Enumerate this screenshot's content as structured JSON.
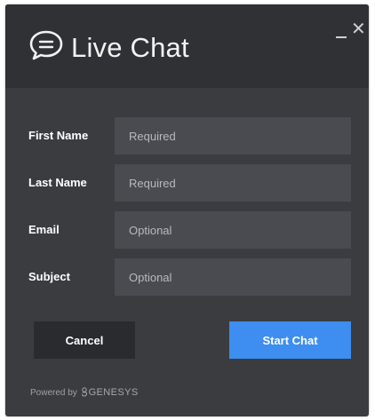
{
  "header": {
    "icon": "chat-bubble-icon",
    "title": "Live Chat",
    "minimize_icon": "minimize-icon",
    "close_icon": "close-icon"
  },
  "form": {
    "fields": [
      {
        "label": "First Name",
        "placeholder": "Required"
      },
      {
        "label": "Last Name",
        "placeholder": "Required"
      },
      {
        "label": "Email",
        "placeholder": "Optional"
      },
      {
        "label": "Subject",
        "placeholder": "Optional"
      }
    ]
  },
  "actions": {
    "cancel_label": "Cancel",
    "start_label": "Start Chat"
  },
  "footer": {
    "powered_by": "Powered by",
    "brand": "GENESYS",
    "brand_icon": "genesys-logo-icon"
  },
  "colors": {
    "panel": "#3a3c40",
    "header": "#2f3134",
    "field": "#494b51",
    "cancel_button": "#2a2b2e",
    "start_button": "#3d8ef0"
  }
}
